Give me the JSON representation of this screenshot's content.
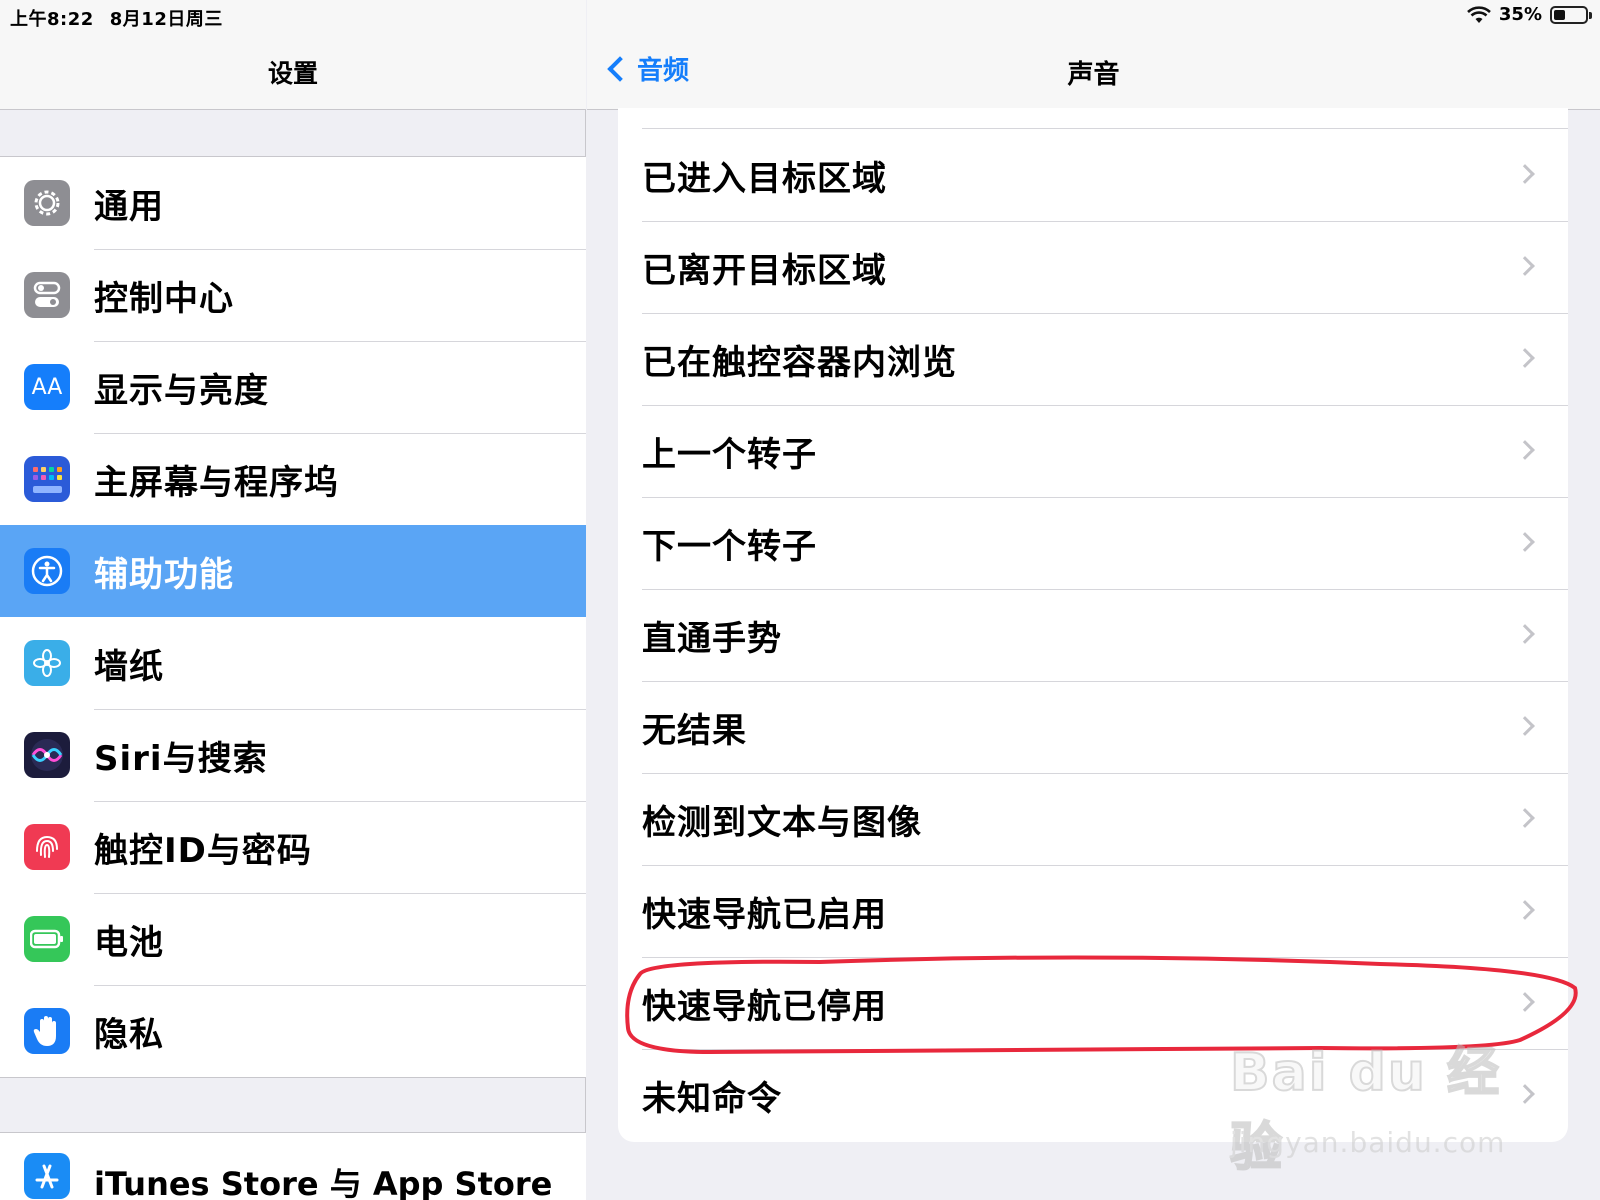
{
  "status_bar": {
    "time": "上午8:22",
    "date": "8月12日周三",
    "battery": "35%",
    "battery_level": 0.35
  },
  "sidebar": {
    "title": "设置",
    "items": [
      {
        "label": "通用",
        "icon": "gear-icon",
        "color": "#8e8e93"
      },
      {
        "label": "控制中心",
        "icon": "toggles-icon",
        "color": "#8e8e93"
      },
      {
        "label": "显示与亮度",
        "icon": "display-aa-icon",
        "color": "#157efb"
      },
      {
        "label": "主屏幕与程序坞",
        "icon": "home-grid-icon",
        "color": "#2b5bd8"
      },
      {
        "label": "辅助功能",
        "icon": "accessibility-icon",
        "color": "#1a7cf5",
        "selected": true
      },
      {
        "label": "墙纸",
        "icon": "flower-icon",
        "color": "#3aaee8"
      },
      {
        "label": "Siri与搜索",
        "icon": "siri-icon",
        "color": "#1c1c3c"
      },
      {
        "label": "触控ID与密码",
        "icon": "fingerprint-icon",
        "color": "#f03a53"
      },
      {
        "label": "电池",
        "icon": "battery-icon",
        "color": "#35c759"
      },
      {
        "label": "隐私",
        "icon": "hand-icon",
        "color": "#1a7cf5"
      }
    ],
    "items_2": [
      {
        "label": "iTunes Store 与 App Store",
        "icon": "app-store-icon",
        "color": "#1a8cf5"
      }
    ]
  },
  "detail": {
    "back_label": "音频",
    "title": "声音",
    "rows": [
      "已进入目标区域",
      "已离开目标区域",
      "已在触控容器内浏览",
      "上一个转子",
      "下一个转子",
      "直通手势",
      "无结果",
      "检测到文本与图像",
      "快速导航已启用",
      "快速导航已停用",
      "未知命令"
    ]
  },
  "annotation": {
    "color": "#e8283c"
  },
  "watermark": {
    "logo": "Bai du 经验",
    "url": "jingyan.baidu.com"
  }
}
